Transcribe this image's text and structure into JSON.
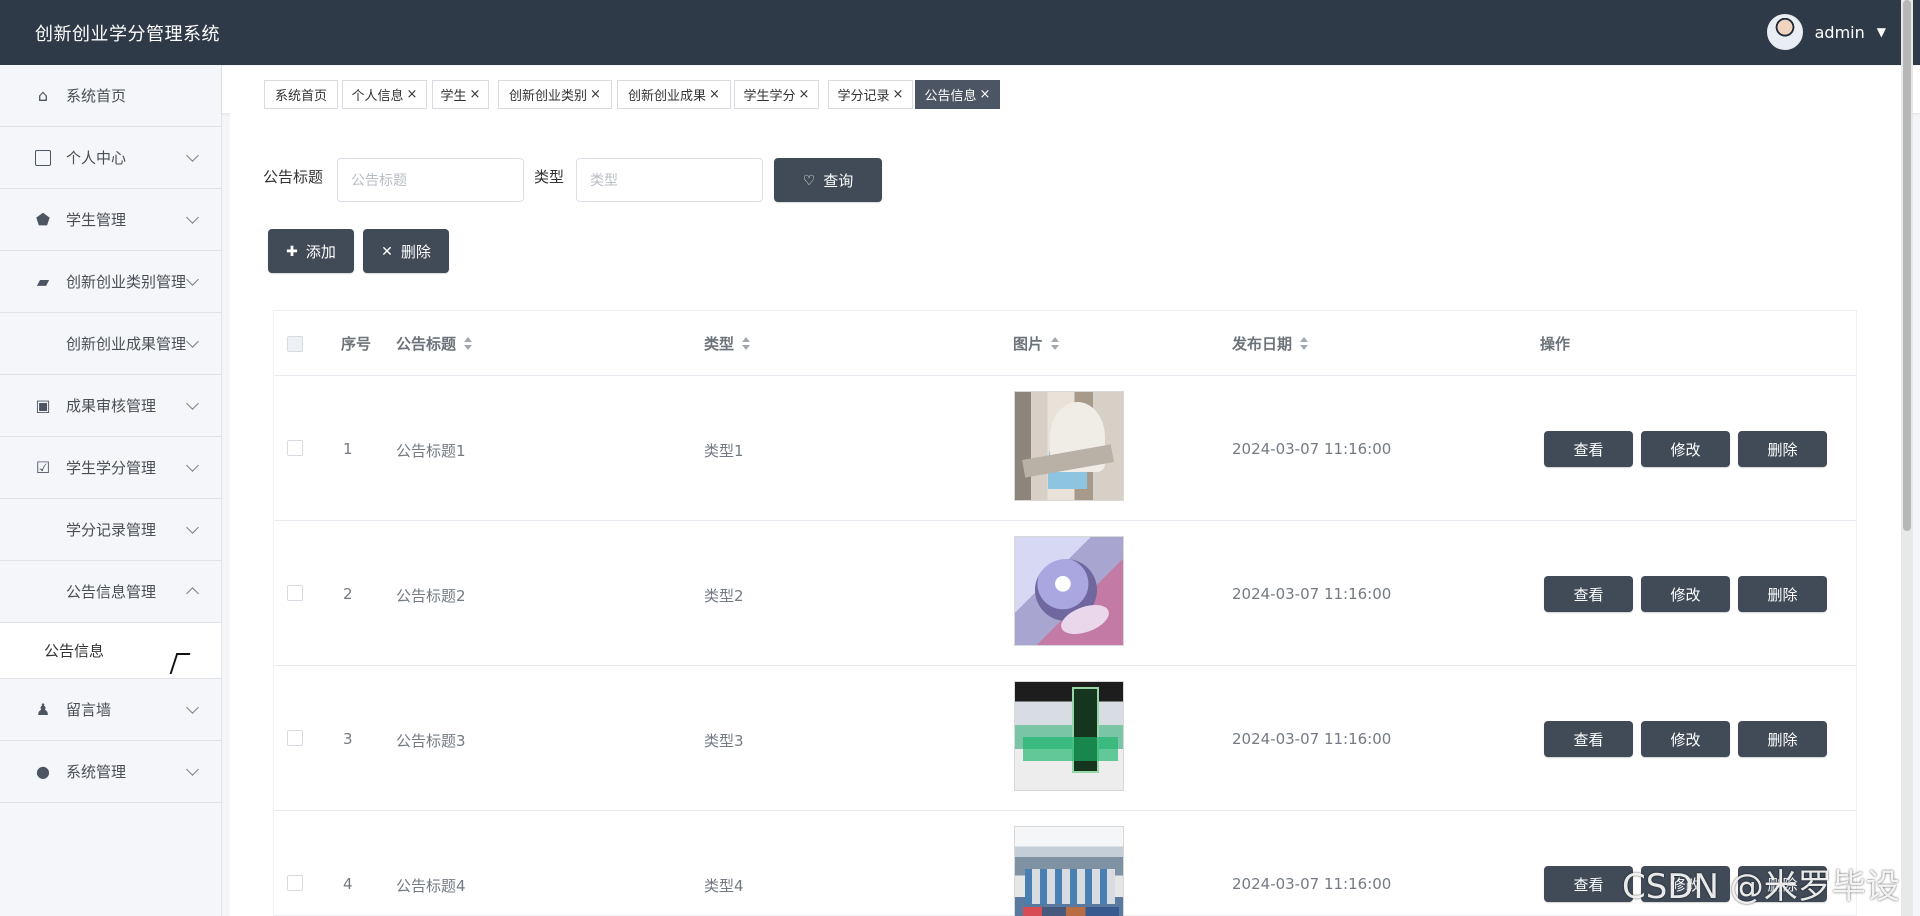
{
  "header": {
    "title": "创新创业学分管理系统",
    "username": "admin"
  },
  "sidebar": {
    "items": [
      {
        "label": "系统首页",
        "icon": "home-icon"
      },
      {
        "label": "个人中心",
        "icon": "card-icon"
      },
      {
        "label": "学生管理",
        "icon": "shield-icon"
      },
      {
        "label": "创新创业类别管理",
        "icon": "briefcase-icon"
      },
      {
        "label": "创新创业成果管理",
        "icon": "grid-icon"
      },
      {
        "label": "成果审核管理",
        "icon": "clipboard-icon"
      },
      {
        "label": "学生学分管理",
        "icon": "clipboard-check-icon"
      },
      {
        "label": "学分记录管理",
        "icon": "grid-icon"
      },
      {
        "label": "公告信息管理",
        "icon": "grid-icon"
      },
      {
        "label": "留言墙",
        "icon": "stamp-icon"
      },
      {
        "label": "系统管理",
        "icon": "user-icon"
      }
    ],
    "subitem": "公告信息"
  },
  "tabs": [
    "系统首页",
    "个人信息",
    "学生",
    "创新创业类别",
    "创新创业成果",
    "学生学分",
    "学分记录",
    "公告信息"
  ],
  "search": {
    "title_label": "公告标题",
    "title_placeholder": "公告标题",
    "type_label": "类型",
    "type_placeholder": "类型",
    "query_button": "查询"
  },
  "toolbar": {
    "add_button": "添加",
    "delete_button": "删除"
  },
  "table": {
    "columns": [
      "序号",
      "公告标题",
      "类型",
      "图片",
      "发布日期",
      "操作"
    ],
    "rows": [
      {
        "index": "1",
        "title": "公告标题1",
        "type": "类型1",
        "date": "2024-03-07 11:16:00"
      },
      {
        "index": "2",
        "title": "公告标题2",
        "type": "类型2",
        "date": "2024-03-07 11:16:00"
      },
      {
        "index": "3",
        "title": "公告标题3",
        "type": "类型3",
        "date": "2024-03-07 11:16:00"
      },
      {
        "index": "4",
        "title": "公告标题4",
        "type": "类型4",
        "date": "2024-03-07 11:16:00"
      }
    ],
    "actions": {
      "view": "查看",
      "edit": "修改",
      "delete": "删除"
    }
  },
  "watermark": "CSDN @米罗毕设",
  "colors": {
    "header": "#2f3a48",
    "button": "#414b58",
    "sidebar": "#f4f6f9"
  }
}
